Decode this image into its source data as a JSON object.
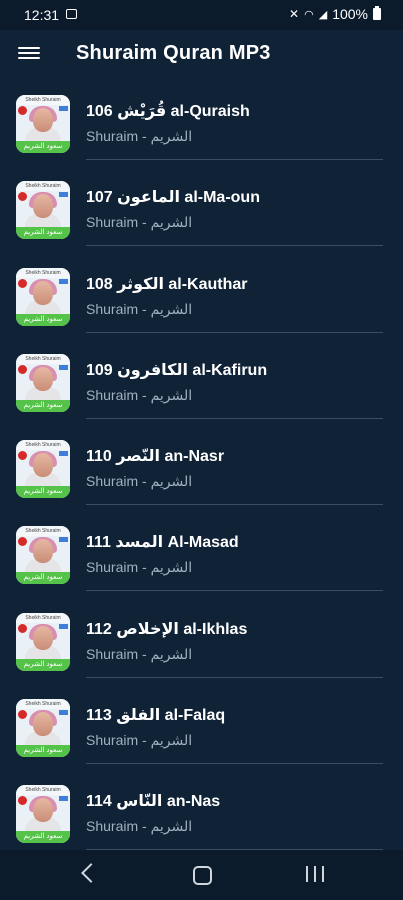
{
  "status": {
    "time": "12:31",
    "battery": "100%"
  },
  "app": {
    "title": "Shuraim Quran MP3"
  },
  "thumb": {
    "banner_text": "Sheikh Shuraim",
    "footer_text": "سعود الشريم"
  },
  "items": [
    {
      "title": "106 قُرَيْش  al-Quraish",
      "subtitle": "Shuraim - الشريم"
    },
    {
      "title": "107 الماعون al-Ma-oun",
      "subtitle": "Shuraim - الشريم"
    },
    {
      "title": "108 الكوثر al-Kauthar",
      "subtitle": "Shuraim - الشريم"
    },
    {
      "title": "109 الكافرون al-Kafirun",
      "subtitle": "Shuraim - الشريم"
    },
    {
      "title": "110 النّصر  an-Nasr",
      "subtitle": "Shuraim - الشريم"
    },
    {
      "title": "111 المسد Al-Masad",
      "subtitle": "Shuraim - الشريم"
    },
    {
      "title": "112 الإخلاص al-Ikhlas",
      "subtitle": "Shuraim - الشريم"
    },
    {
      "title": "113 الفلق al-Falaq",
      "subtitle": "Shuraim - الشريم"
    },
    {
      "title": "114 النّاس an-Nas",
      "subtitle": "Shuraim - الشريم"
    }
  ]
}
